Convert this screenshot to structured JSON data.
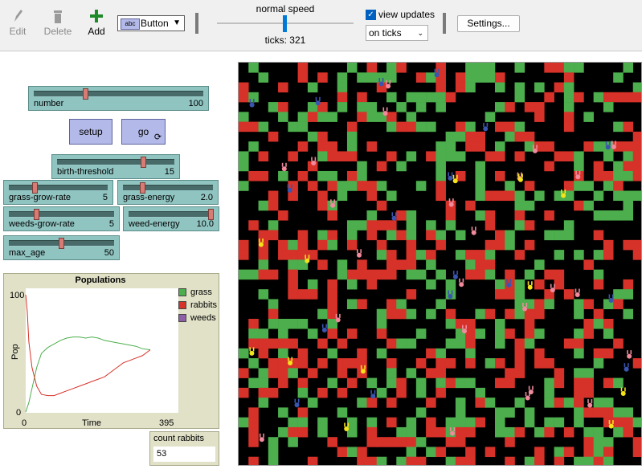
{
  "toolbar": {
    "edit_label": "Edit",
    "delete_label": "Delete",
    "add_label": "Add",
    "widget_type": "Button",
    "widget_type_icon": "abc",
    "speed_label": "normal speed",
    "speed_level": 0.5,
    "ticks_label": "ticks: 321",
    "view_updates_label": "view updates",
    "view_updates_checked": true,
    "update_mode": "on ticks",
    "settings_label": "Settings..."
  },
  "sliders": {
    "number": {
      "label": "number",
      "value": "100",
      "level": 0.3
    },
    "birth_threshold": {
      "label": "birth-threshold",
      "value": "15",
      "level": 0.75
    },
    "grass_grow_rate": {
      "label": "grass-grow-rate",
      "value": "5",
      "level": 0.25
    },
    "grass_energy": {
      "label": "grass-energy",
      "value": "2.0",
      "level": 0.2
    },
    "weeds_grow_rate": {
      "label": "weeds-grow-rate",
      "value": "5",
      "level": 0.25
    },
    "weed_energy": {
      "label": "weed-energy",
      "value": "10.0",
      "level": 1.0
    },
    "max_age": {
      "label": "max_age",
      "value": "50",
      "level": 0.5
    }
  },
  "buttons": {
    "setup_label": "setup",
    "go_label": "go"
  },
  "plot": {
    "title": "Populations",
    "ylabel": "Pop",
    "xlabel": "Time",
    "y_min_label": "0",
    "y_max_label": "100",
    "x_min_label": "0",
    "x_max_label": "395",
    "legend": [
      {
        "name": "grass",
        "color": "#4cae4c"
      },
      {
        "name": "rabbits",
        "color": "#d73229"
      },
      {
        "name": "weeds",
        "color": "#8e5fa8"
      }
    ]
  },
  "chart_data": {
    "type": "line",
    "title": "Populations",
    "xlabel": "Time",
    "ylabel": "Pop",
    "xlim": [
      0,
      395
    ],
    "ylim": [
      0,
      100
    ],
    "legend": "right",
    "series": [
      {
        "name": "grass",
        "color": "#4cae4c",
        "x": [
          0,
          10,
          20,
          35,
          50,
          70,
          90,
          110,
          130,
          150,
          170,
          190,
          210,
          230,
          250,
          270,
          290,
          310,
          330,
          350,
          370,
          395
        ],
        "y": [
          0,
          8,
          20,
          38,
          50,
          55,
          58,
          61,
          63,
          64,
          64,
          63,
          64,
          63,
          61,
          60,
          59,
          58,
          57,
          56,
          54,
          53
        ]
      },
      {
        "name": "rabbits",
        "color": "#d73229",
        "x": [
          0,
          5,
          10,
          20,
          35,
          50,
          70,
          90,
          110,
          130,
          150,
          170,
          190,
          210,
          230,
          250,
          270,
          290,
          310,
          330,
          350,
          370,
          395
        ],
        "y": [
          100,
          85,
          60,
          38,
          22,
          15,
          14,
          14,
          16,
          18,
          20,
          22,
          24,
          26,
          28,
          30,
          34,
          38,
          42,
          44,
          46,
          48,
          53
        ]
      },
      {
        "name": "weeds",
        "color": "#8e5fa8",
        "x": [],
        "y": []
      }
    ]
  },
  "monitor": {
    "label": "count rabbits",
    "value": "53"
  },
  "colors": {
    "grass_patch": "#4cae4c",
    "weed_patch": "#d73229",
    "rabbit_pink": "#f08a9c",
    "rabbit_blue": "#3a55b0",
    "rabbit_yellow": "#f4e21c"
  }
}
